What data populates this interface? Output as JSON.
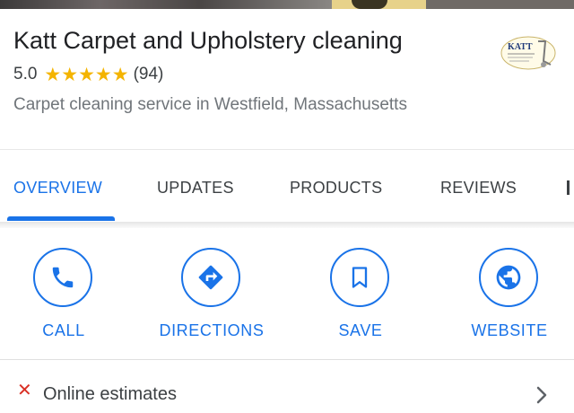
{
  "place": {
    "name": "Katt Carpet and Upholstery cleaning",
    "rating": "5.0",
    "stars": 5,
    "review_count": "(94)",
    "category": "Carpet cleaning service in Westfield, Massachusetts",
    "logo": {
      "text": "KATT"
    }
  },
  "tabs": [
    {
      "label": "OVERVIEW",
      "active": true
    },
    {
      "label": "UPDATES",
      "active": false
    },
    {
      "label": "PRODUCTS",
      "active": false
    },
    {
      "label": "REVIEWS",
      "active": false
    }
  ],
  "actions": [
    {
      "label": "CALL",
      "icon": "phone-icon"
    },
    {
      "label": "DIRECTIONS",
      "icon": "directions-icon"
    },
    {
      "label": "SAVE",
      "icon": "bookmark-icon"
    },
    {
      "label": "WEBSITE",
      "icon": "globe-icon"
    }
  ],
  "attributes": [
    {
      "label": "Online estimates",
      "status": "unavailable",
      "icon": "x-icon"
    }
  ],
  "colors": {
    "accent": "#1a73e8",
    "star": "#f4b400",
    "negative": "#d93025"
  }
}
